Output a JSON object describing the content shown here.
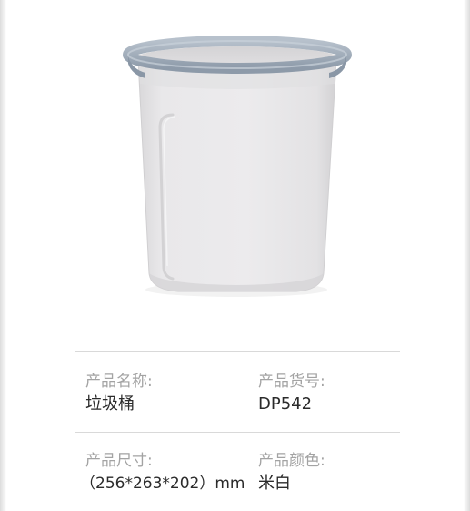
{
  "product": {
    "image_icon": "trash-bin-icon",
    "colors": {
      "body": "#e8e7e8",
      "rim": "#9aa7b6",
      "divider": "#d9d9d9",
      "label": "#a3a3a3",
      "value": "#2b2b2b"
    }
  },
  "specs": {
    "name_label": "产品名称:",
    "name_value": "垃圾桶",
    "code_label": "产品货号:",
    "code_value": "DP542",
    "size_label": "产品尺寸:",
    "size_value": "（256*263*202）mm",
    "color_label": "产品颜色:",
    "color_value": "米白"
  }
}
